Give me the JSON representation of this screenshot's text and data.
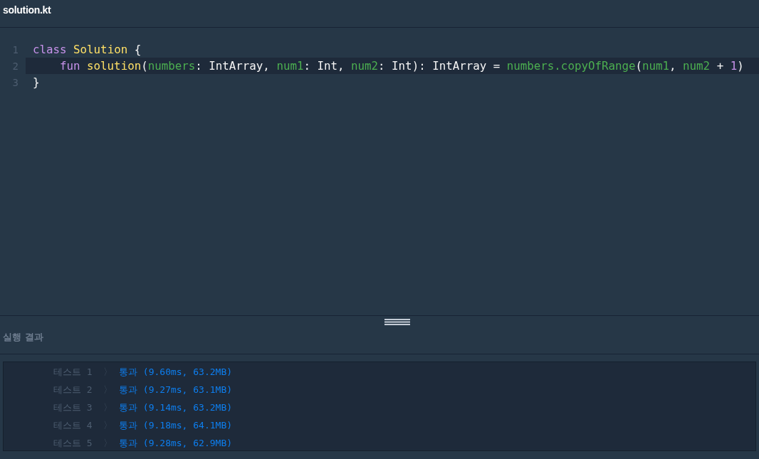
{
  "file_tab": {
    "title": "solution.kt"
  },
  "code": {
    "lines": [
      {
        "number": "1",
        "active": false,
        "indented": false,
        "tokens": [
          {
            "text": "class ",
            "kind": "keyword"
          },
          {
            "text": "Solution",
            "kind": "function"
          },
          {
            "text": " {",
            "kind": "plain"
          }
        ]
      },
      {
        "number": "2",
        "active": true,
        "indented": true,
        "tokens": [
          {
            "text": "fun ",
            "kind": "keyword"
          },
          {
            "text": "solution",
            "kind": "function"
          },
          {
            "text": "(",
            "kind": "plain"
          },
          {
            "text": "numbers",
            "kind": "variable"
          },
          {
            "text": ": IntArray, ",
            "kind": "plain"
          },
          {
            "text": "num1",
            "kind": "variable"
          },
          {
            "text": ": Int, ",
            "kind": "plain"
          },
          {
            "text": "num2",
            "kind": "variable"
          },
          {
            "text": ": Int): IntArray = ",
            "kind": "plain"
          },
          {
            "text": "numbers.copyOfRange",
            "kind": "variable"
          },
          {
            "text": "(",
            "kind": "plain"
          },
          {
            "text": "num1",
            "kind": "variable"
          },
          {
            "text": ", ",
            "kind": "plain"
          },
          {
            "text": "num2",
            "kind": "variable"
          },
          {
            "text": " + ",
            "kind": "plain"
          },
          {
            "text": "1",
            "kind": "number"
          },
          {
            "text": ")",
            "kind": "plain"
          }
        ]
      },
      {
        "number": "3",
        "active": false,
        "indented": false,
        "tokens": [
          {
            "text": "}",
            "kind": "plain"
          }
        ]
      }
    ]
  },
  "results": {
    "title": "실행 결과",
    "tests": [
      {
        "label": "테스트 1",
        "chevron": "〉",
        "result": "통과 (9.60ms, 63.2MB)"
      },
      {
        "label": "테스트 2",
        "chevron": "〉",
        "result": "통과 (9.27ms, 63.1MB)"
      },
      {
        "label": "테스트 3",
        "chevron": "〉",
        "result": "통과 (9.14ms, 63.2MB)"
      },
      {
        "label": "테스트 4",
        "chevron": "〉",
        "result": "통과 (9.18ms, 64.1MB)"
      },
      {
        "label": "테스트 5",
        "chevron": "〉",
        "result": "통과 (9.28ms, 62.9MB)"
      }
    ]
  }
}
